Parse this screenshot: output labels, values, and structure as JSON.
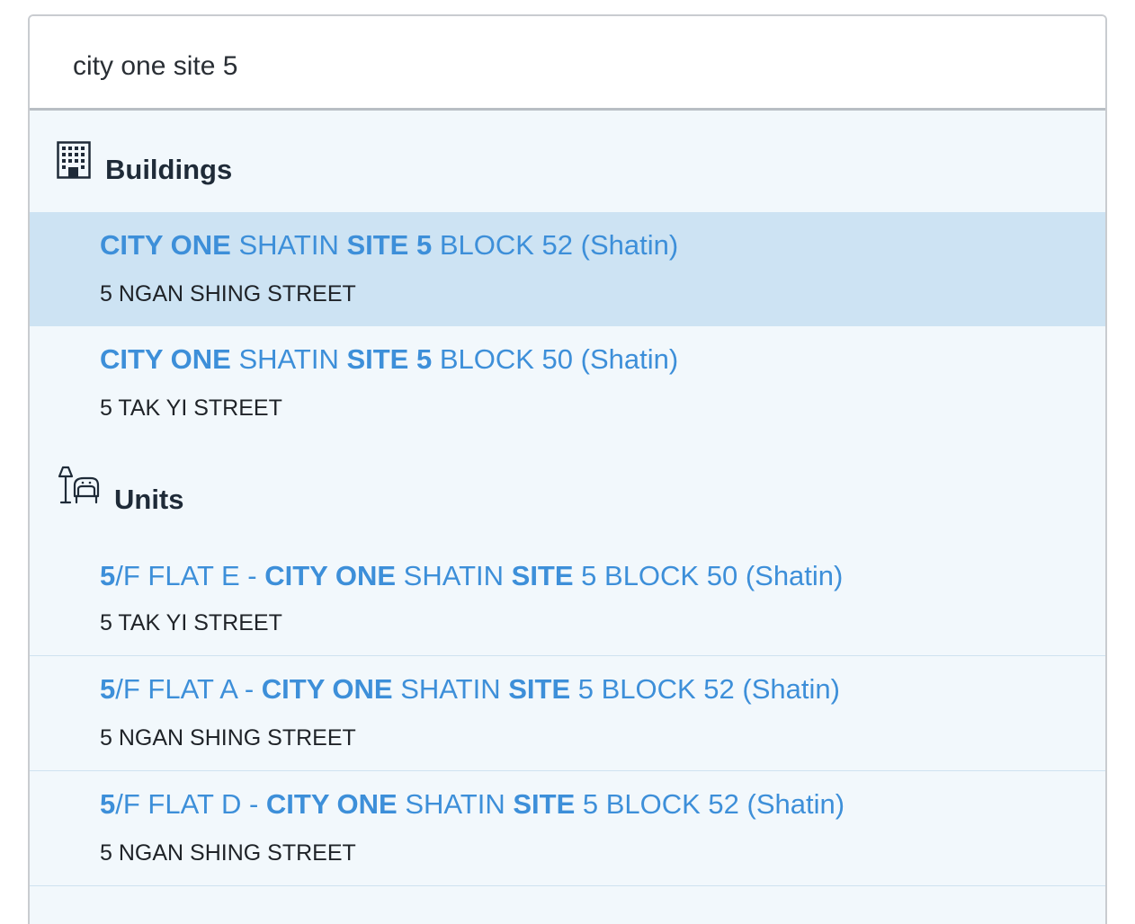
{
  "search": {
    "value": "city one site 5"
  },
  "sections": {
    "buildings": {
      "title": "Buildings",
      "icon": "building-icon"
    },
    "units": {
      "title": "Units",
      "icon": "furniture-icon"
    }
  },
  "buildings": [
    {
      "segments": [
        {
          "text": "CITY ONE",
          "bold": true
        },
        {
          "text": " SHATIN ",
          "bold": false
        },
        {
          "text": "SITE 5",
          "bold": true
        },
        {
          "text": " BLOCK 52 (Shatin)",
          "bold": false
        }
      ],
      "address": "5 NGAN SHING STREET",
      "highlighted": true
    },
    {
      "segments": [
        {
          "text": "CITY ONE",
          "bold": true
        },
        {
          "text": " SHATIN ",
          "bold": false
        },
        {
          "text": "SITE 5",
          "bold": true
        },
        {
          "text": " BLOCK 50 (Shatin)",
          "bold": false
        }
      ],
      "address": "5 TAK YI STREET",
      "highlighted": false
    }
  ],
  "units": [
    {
      "segments": [
        {
          "text": "5",
          "bold": true
        },
        {
          "text": "/F FLAT E - ",
          "bold": false
        },
        {
          "text": "CITY ONE",
          "bold": true
        },
        {
          "text": " SHATIN ",
          "bold": false
        },
        {
          "text": "SITE",
          "bold": true
        },
        {
          "text": " 5 BLOCK 50 (Shatin)",
          "bold": false
        }
      ],
      "address": "5 TAK YI STREET"
    },
    {
      "segments": [
        {
          "text": "5",
          "bold": true
        },
        {
          "text": "/F FLAT A - ",
          "bold": false
        },
        {
          "text": "CITY ONE",
          "bold": true
        },
        {
          "text": " SHATIN ",
          "bold": false
        },
        {
          "text": "SITE",
          "bold": true
        },
        {
          "text": " 5 BLOCK 52 (Shatin)",
          "bold": false
        }
      ],
      "address": "5 NGAN SHING STREET"
    },
    {
      "segments": [
        {
          "text": "5",
          "bold": true
        },
        {
          "text": "/F FLAT D - ",
          "bold": false
        },
        {
          "text": "CITY ONE",
          "bold": true
        },
        {
          "text": " SHATIN ",
          "bold": false
        },
        {
          "text": "SITE",
          "bold": true
        },
        {
          "text": " 5 BLOCK 52 (Shatin)",
          "bold": false
        }
      ],
      "address": "5 NGAN SHING STREET"
    }
  ],
  "colors": {
    "link": "#3d8fd9",
    "highlight": "#cde3f3",
    "panel": "#f2f8fc"
  }
}
